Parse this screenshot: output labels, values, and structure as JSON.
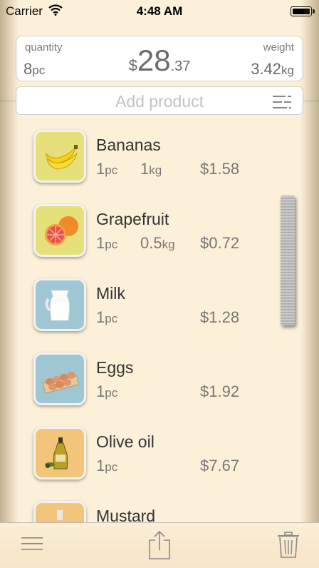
{
  "status_bar": {
    "carrier": "Carrier",
    "time": "4:48 AM"
  },
  "summary": {
    "quantity_label": "quantity",
    "quantity_value": "8",
    "quantity_unit": "pc",
    "currency": "$",
    "total_whole": "28",
    "total_cents": ".37",
    "weight_label": "weight",
    "weight_value": "3.42",
    "weight_unit": "kg"
  },
  "add_product": {
    "placeholder": "Add product"
  },
  "items": [
    {
      "name": "Bananas",
      "qty": "1",
      "qty_unit": "pc",
      "weight": "1",
      "weight_unit": "kg",
      "price": "1.58",
      "icon": "banana-icon",
      "bg": "#e6e07a"
    },
    {
      "name": "Grapefruit",
      "qty": "1",
      "qty_unit": "pc",
      "weight": "0.5",
      "weight_unit": "kg",
      "price": "0.72",
      "icon": "grapefruit-icon",
      "bg": "#e6e07a"
    },
    {
      "name": "Milk",
      "qty": "1",
      "qty_unit": "pc",
      "weight": "",
      "weight_unit": "",
      "price": "1.28",
      "icon": "milk-icon",
      "bg": "#9ec6d3"
    },
    {
      "name": "Eggs",
      "qty": "1",
      "qty_unit": "pc",
      "weight": "",
      "weight_unit": "",
      "price": "1.92",
      "icon": "eggs-icon",
      "bg": "#9ec6d3"
    },
    {
      "name": "Olive oil",
      "qty": "1",
      "qty_unit": "pc",
      "weight": "",
      "weight_unit": "",
      "price": "7.67",
      "icon": "olive-oil-icon",
      "bg": "#f2c57a"
    },
    {
      "name": "Mustard",
      "qty": "",
      "qty_unit": "",
      "weight": "",
      "weight_unit": "",
      "price": "",
      "icon": "mustard-icon",
      "bg": "#f2c57a"
    }
  ],
  "toolbar": {
    "menu_icon": "menu-icon",
    "share_icon": "share-icon",
    "trash_icon": "trash-icon"
  }
}
